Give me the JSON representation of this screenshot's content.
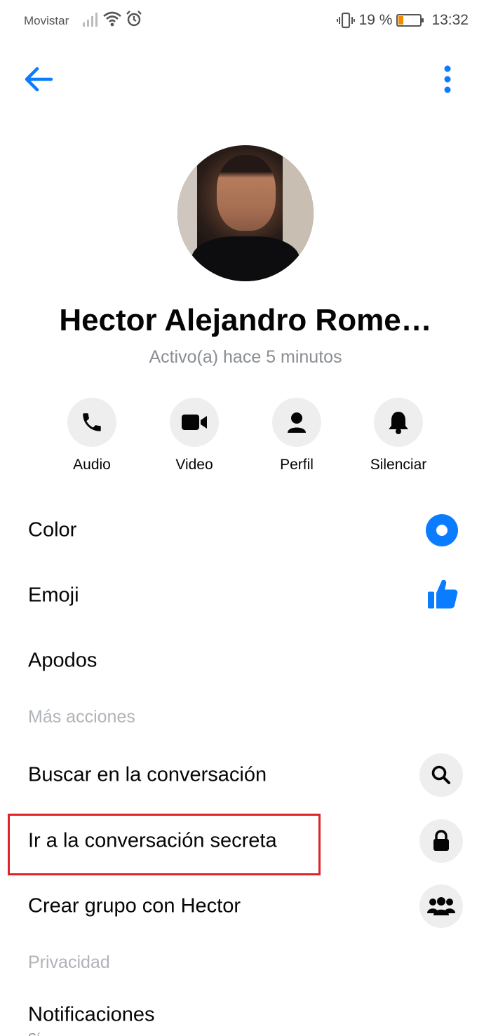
{
  "status_bar": {
    "carrier": "Movistar",
    "battery_percent": "19 %",
    "time": "13:32"
  },
  "colors": {
    "accent": "#0a7cff",
    "highlight": "#e0222a"
  },
  "contact": {
    "name": "Hector Alejandro Rome…",
    "status": "Activo(a) hace 5 minutos"
  },
  "actions": [
    {
      "label": "Audio",
      "icon": "phone-icon"
    },
    {
      "label": "Video",
      "icon": "video-camera-icon"
    },
    {
      "label": "Perfil",
      "icon": "profile-icon"
    },
    {
      "label": "Silenciar",
      "icon": "bell-icon"
    }
  ],
  "settings": {
    "color_label": "Color",
    "emoji_label": "Emoji",
    "nicknames_label": "Apodos"
  },
  "more_actions": {
    "header": "Más acciones",
    "search_label": "Buscar en la conversación",
    "secret_label": "Ir a la conversación secreta",
    "group_label": "Crear grupo con Hector"
  },
  "privacy": {
    "header": "Privacidad",
    "notifications_label": "Notificaciones",
    "notifications_sub": "Sí"
  }
}
